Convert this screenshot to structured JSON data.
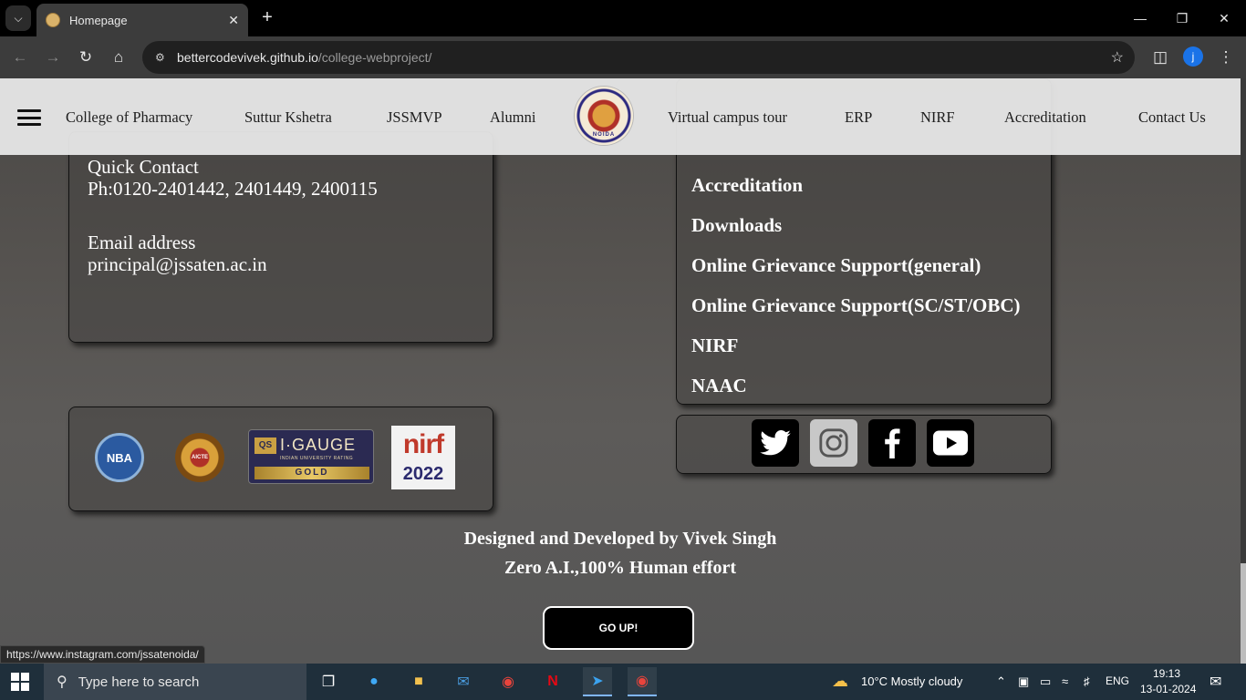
{
  "browser": {
    "tab_title": "Homepage",
    "url_domain": "bettercodevivek.github.io",
    "url_path": "/college-webproject/",
    "profile_initial": "j"
  },
  "site_nav": {
    "links": [
      "College of Pharmacy",
      "Suttur Kshetra",
      "JSSMVP",
      "Alumni",
      "Virtual campus tour",
      "ERP",
      "NIRF",
      "Accreditation",
      "Contact Us"
    ],
    "logo_text": "NOIDA"
  },
  "contact": {
    "quick_title": "Quick Contact",
    "phone": "Ph:0120-2401442, 2401449, 2400115",
    "email_title": "Email address",
    "email": "principal@jssaten.ac.in"
  },
  "links_card": {
    "items": [
      "Accreditation",
      "Downloads",
      "Online Grievance Support(general)",
      "Online Grievance Support(SC/ST/OBC)",
      "NIRF",
      "NAAC"
    ]
  },
  "badges": {
    "nba": "NBA",
    "aicte": "AICTE",
    "igauge_qs": "QS",
    "igauge": "I·GAUGE",
    "igauge_sub": "INDIAN UNIVERSITY RATING",
    "igauge_tier": "GOLD",
    "nirf": "nirf",
    "nirf_year": "2022"
  },
  "footer": {
    "credit": "Designed and Developed by Vivek Singh",
    "tagline": "Zero A.I.,100% Human effort",
    "go_up": "GO UP!"
  },
  "status_bar_url": "https://www.instagram.com/jssatenoida/",
  "taskbar": {
    "search_placeholder": "Type here to search",
    "weather": "10°C  Mostly cloudy",
    "lang": "ENG",
    "time": "19:13",
    "date": "13-01-2024"
  }
}
